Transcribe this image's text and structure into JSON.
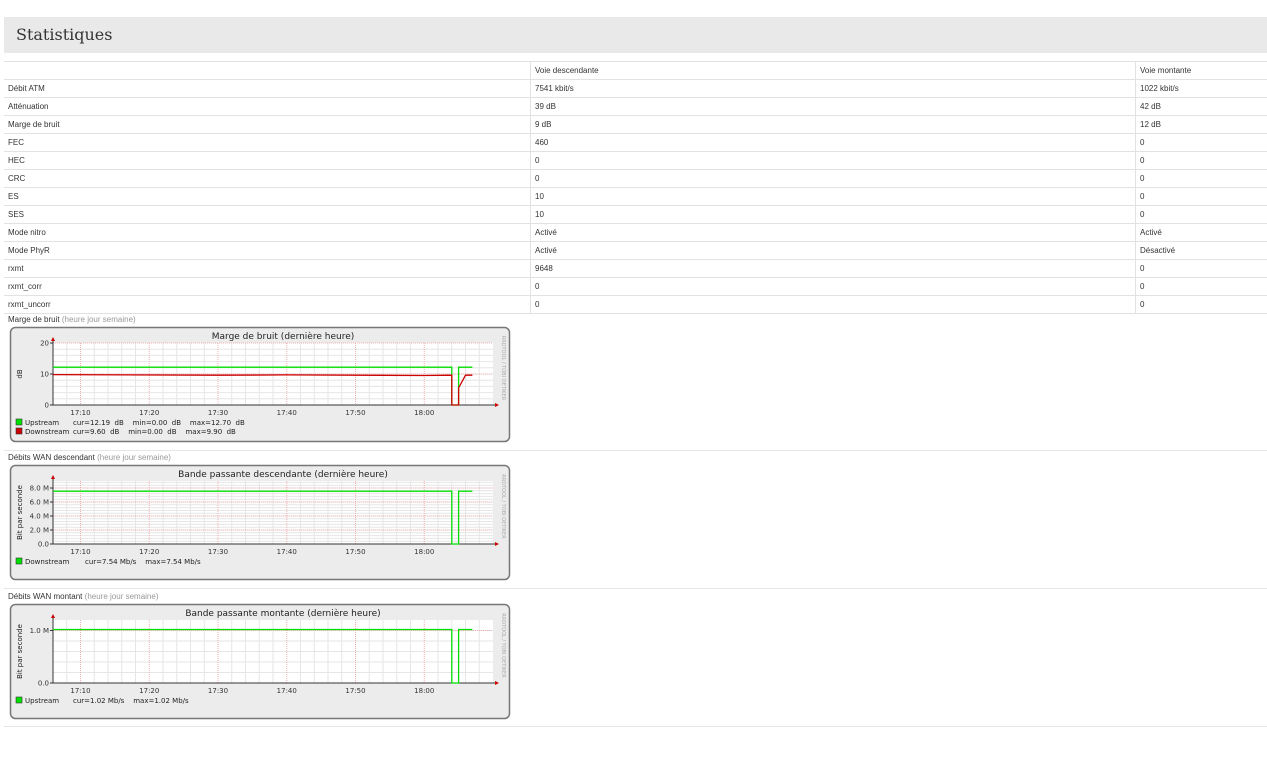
{
  "page_title": "Statistiques",
  "table": {
    "headers": [
      "",
      "Voie descendante",
      "Voie montante"
    ],
    "rows": [
      [
        "Débit ATM",
        "7541 kbit/s",
        "1022 kbit/s"
      ],
      [
        "Atténuation",
        "39 dB",
        "42 dB"
      ],
      [
        "Marge de bruit",
        "9 dB",
        "12 dB"
      ],
      [
        "FEC",
        "460",
        "0"
      ],
      [
        "HEC",
        "0",
        "0"
      ],
      [
        "CRC",
        "0",
        "0"
      ],
      [
        "ES",
        "10",
        "0"
      ],
      [
        "SES",
        "10",
        "0"
      ],
      [
        "Mode nitro",
        "Activé",
        "Activé"
      ],
      [
        "Mode PhyR",
        "Activé",
        "Désactivé"
      ],
      [
        "rxmt",
        "9648",
        "0"
      ],
      [
        "rxmt_corr",
        "0",
        "0"
      ],
      [
        "rxmt_uncorr",
        "0",
        "0"
      ]
    ]
  },
  "colors": {
    "green": "#00e000",
    "red": "#cc0000",
    "grid_minor": "#e6e6e6",
    "grid_major": "#f0b0b0"
  },
  "graphs": [
    {
      "section_label": "Marge de bruit",
      "period_links": [
        "heure",
        "jour",
        "semaine"
      ],
      "period_open": "(",
      "period_close": ")",
      "watermark": "RRDTOOL / TOBI OETIKER"
    },
    {
      "section_label": "Débits WAN descendant",
      "period_links": [
        "heure",
        "jour",
        "semaine"
      ],
      "period_open": "(",
      "period_close": ")",
      "watermark": "RRDTOOL / TOBI OETIKER"
    },
    {
      "section_label": "Débits WAN montant",
      "period_links": [
        "heure",
        "jour",
        "semaine"
      ],
      "period_open": "(",
      "period_close": ")",
      "watermark": "RRDTOOL / TOBI OETIKER"
    }
  ],
  "chart_data": [
    {
      "type": "line",
      "title": "Marge de bruit (dernière heure)",
      "ylabel": "dB",
      "ylim": [
        0,
        20
      ],
      "yticks": [
        0,
        10,
        20
      ],
      "ytick_labels": [
        "0",
        "10",
        "20"
      ],
      "xlim": [
        "17:06",
        "18:10"
      ],
      "x_tick_labels": [
        "17:10",
        "17:20",
        "17:30",
        "17:40",
        "17:50",
        "18:00"
      ],
      "grid": true,
      "series": [
        {
          "name": "Upstream",
          "color": "#00e000",
          "x": [
            "17:06",
            "18:04",
            "18:04",
            "18:05",
            "18:05",
            "18:06",
            "18:07"
          ],
          "y": [
            12.19,
            12.19,
            0,
            0,
            12.19,
            12.19,
            12.19
          ]
        },
        {
          "name": "Downstream",
          "color": "#cc0000",
          "x": [
            "17:06",
            "17:30",
            "17:40",
            "18:00",
            "18:04",
            "18:04",
            "18:05",
            "18:05",
            "18:06",
            "18:07"
          ],
          "y": [
            9.8,
            9.6,
            9.7,
            9.5,
            9.6,
            0,
            0,
            5.5,
            9.6,
            9.6
          ]
        }
      ],
      "legend": [
        {
          "name": "Upstream",
          "color": "#00e000",
          "stats": "cur=12.19  dB    min=0.00  dB    max=12.70  dB"
        },
        {
          "name": "Downstream",
          "color": "#cc0000",
          "stats": "cur=9.60  dB    min=0.00  dB    max=9.90  dB"
        }
      ]
    },
    {
      "type": "line",
      "title": "Bande passante descendante (dernière heure)",
      "ylabel": "Bit par seconde",
      "ylim": [
        0,
        9000000
      ],
      "yticks": [
        0,
        2000000,
        4000000,
        6000000,
        8000000
      ],
      "ytick_labels": [
        "0.0",
        "2.0 M",
        "4.0 M",
        "6.0 M",
        "8.0 M"
      ],
      "xlim": [
        "17:06",
        "18:10"
      ],
      "x_tick_labels": [
        "17:10",
        "17:20",
        "17:30",
        "17:40",
        "17:50",
        "18:00"
      ],
      "grid": true,
      "series": [
        {
          "name": "Downstream",
          "color": "#00e000",
          "x": [
            "17:06",
            "18:04",
            "18:04",
            "18:05",
            "18:05",
            "18:07"
          ],
          "y": [
            7540000,
            7540000,
            0,
            0,
            7540000,
            7540000
          ]
        }
      ],
      "legend": [
        {
          "name": "Downstream",
          "color": "#00e000",
          "stats": "cur=7.54 Mb/s    max=7.54 Mb/s"
        }
      ]
    },
    {
      "type": "line",
      "title": "Bande passante montante (dernière heure)",
      "ylabel": "Bit par seconde",
      "ylim": [
        0,
        1200000
      ],
      "yticks": [
        0,
        1000000
      ],
      "ytick_labels": [
        "0.0",
        "1.0 M"
      ],
      "xlim": [
        "17:06",
        "18:10"
      ],
      "x_tick_labels": [
        "17:10",
        "17:20",
        "17:30",
        "17:40",
        "17:50",
        "18:00"
      ],
      "grid": true,
      "series": [
        {
          "name": "Upstream",
          "color": "#00e000",
          "x": [
            "17:06",
            "18:04",
            "18:04",
            "18:05",
            "18:05",
            "18:07"
          ],
          "y": [
            1020000,
            1020000,
            0,
            0,
            1020000,
            1020000
          ]
        }
      ],
      "legend": [
        {
          "name": "Upstream",
          "color": "#00e000",
          "stats": "cur=1.02 Mb/s    max=1.02 Mb/s"
        }
      ]
    }
  ]
}
